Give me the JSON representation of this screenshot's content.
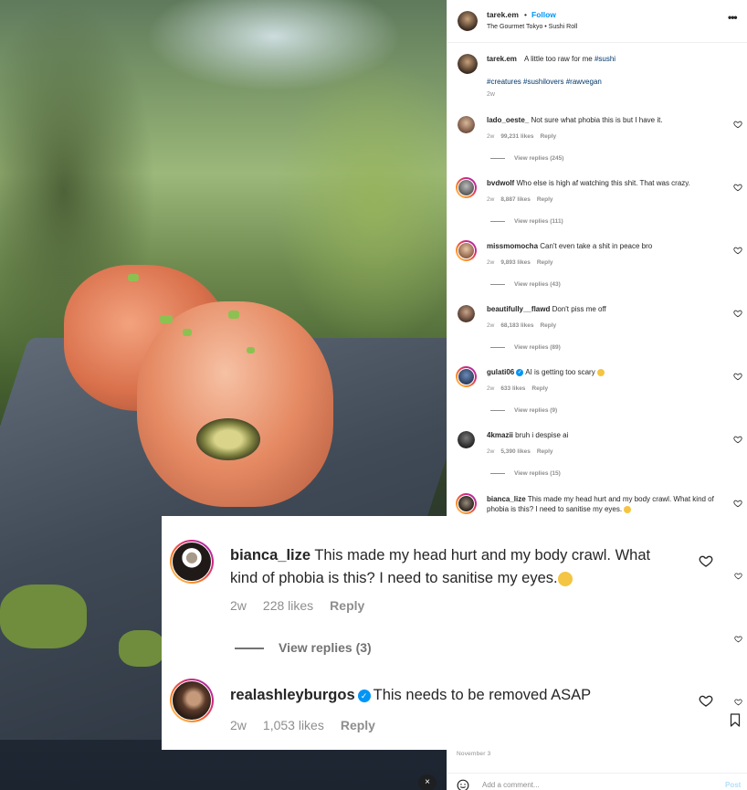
{
  "post": {
    "username": "tarek.em",
    "follow_label": "Follow",
    "separator": "•",
    "subtitle": "The Gourmet Tokyo • Sushi Roll",
    "more_label": "•••",
    "caption_text": "A little too raw for me",
    "caption_tag": "#sushi",
    "caption_tags": "#creatures #sushilovers #rawvegan",
    "caption_time": "2w",
    "date": "November 3",
    "add_comment_placeholder": "Add a comment...",
    "post_label": "Post"
  },
  "comments": [
    {
      "user": "lado_oeste_",
      "text": "Not sure what phobia this is but I have it.",
      "time": "2w",
      "likes": "99,231 likes",
      "reply": "Reply",
      "view_replies": "View replies (245)"
    },
    {
      "user": "bvdwolf",
      "text": "Who else is high af watching this shit. That was crazy.",
      "time": "2w",
      "likes": "8,887 likes",
      "reply": "Reply",
      "view_replies": "View replies (111)"
    },
    {
      "user": "missmomocha",
      "text": "Can't even take a shit in peace bro",
      "time": "2w",
      "likes": "9,893 likes",
      "reply": "Reply",
      "view_replies": "View replies (43)"
    },
    {
      "user": "beautifully__flawd",
      "text": "Don't piss me off",
      "time": "2w",
      "likes": "68,183 likes",
      "reply": "Reply",
      "view_replies": "View replies (89)"
    },
    {
      "user": "gulati06",
      "text": "AI is getting too scary",
      "time": "2w",
      "likes": "633 likes",
      "reply": "Reply",
      "view_replies": "View replies (9)"
    },
    {
      "user": "4kmazii",
      "text": "bruh i despise ai",
      "time": "2w",
      "likes": "5,390 likes",
      "reply": "Reply",
      "view_replies": "View replies (15)"
    },
    {
      "user": "bianca_lize",
      "text": "This made my head hurt and my body crawl. What kind of phobia is this? I need to sanitise my eyes."
    }
  ],
  "zoom": {
    "c1": {
      "user": "bianca_lize",
      "line1": "This made my head hurt and my body crawl. What",
      "line2": "kind of phobia is this? I need to sanitise my eyes.",
      "time": "2w",
      "likes": "228 likes",
      "reply": "Reply",
      "view_replies": "View replies (3)"
    },
    "c2": {
      "user": "realashleyburgos",
      "text": "This needs to be removed ASAP",
      "time": "2w",
      "likes": "1,053 likes",
      "reply": "Reply"
    }
  },
  "icons": {
    "verified": "✓",
    "mute": "🔇"
  }
}
